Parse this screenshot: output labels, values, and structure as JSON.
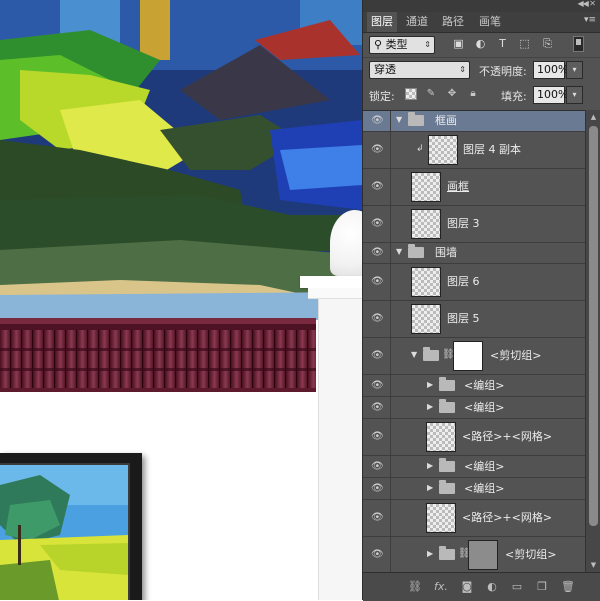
{
  "canvas": {
    "description_hidden": ""
  },
  "panel": {
    "tabs": [
      "图层",
      "通道",
      "路径",
      "画笔"
    ],
    "active_tab": "图层",
    "filter_select": "类型",
    "filter_icons": [
      "image-filter-icon",
      "adjustment-filter-icon",
      "type-filter-icon",
      "shape-filter-icon",
      "smart-object-filter-icon"
    ],
    "blend_mode": "穿透",
    "opacity_label": "不透明度:",
    "opacity_value": "100%",
    "lock_label": "锁定:",
    "fill_label": "填充:",
    "fill_value": "100%",
    "layers": [
      {
        "name": "框画",
        "type": "group",
        "expanded": true,
        "selected": true
      },
      {
        "name": "图层 4 副本",
        "type": "layer-clipped"
      },
      {
        "name": "画框",
        "type": "layer",
        "underline": true
      },
      {
        "name": "图层 3",
        "type": "layer"
      },
      {
        "name": "围墙",
        "type": "group",
        "expanded": true
      },
      {
        "name": "图层 6",
        "type": "layer"
      },
      {
        "name": "图层 5",
        "type": "layer"
      },
      {
        "name": "<剪切组>",
        "type": "clip-group",
        "expanded": true
      },
      {
        "name": "<编组>",
        "type": "group"
      },
      {
        "name": "<编组>",
        "type": "group"
      },
      {
        "name": "<路径>+<网格>",
        "type": "layer"
      },
      {
        "name": "<编组>",
        "type": "group"
      },
      {
        "name": "<编组>",
        "type": "group"
      },
      {
        "name": "<路径>+<网格>",
        "type": "layer"
      },
      {
        "name": "<剪切组>",
        "type": "clip-group"
      }
    ],
    "bottom_icons": [
      "link-layers-icon",
      "fx-icon",
      "layer-mask-icon",
      "adjustment-layer-icon",
      "new-group-icon",
      "new-layer-icon",
      "delete-icon"
    ],
    "bottom_fx_text": "fx."
  },
  "colors": {
    "panel_bg": "#535353",
    "selected_row": "#6a7a93",
    "roof": "#6e2136"
  }
}
